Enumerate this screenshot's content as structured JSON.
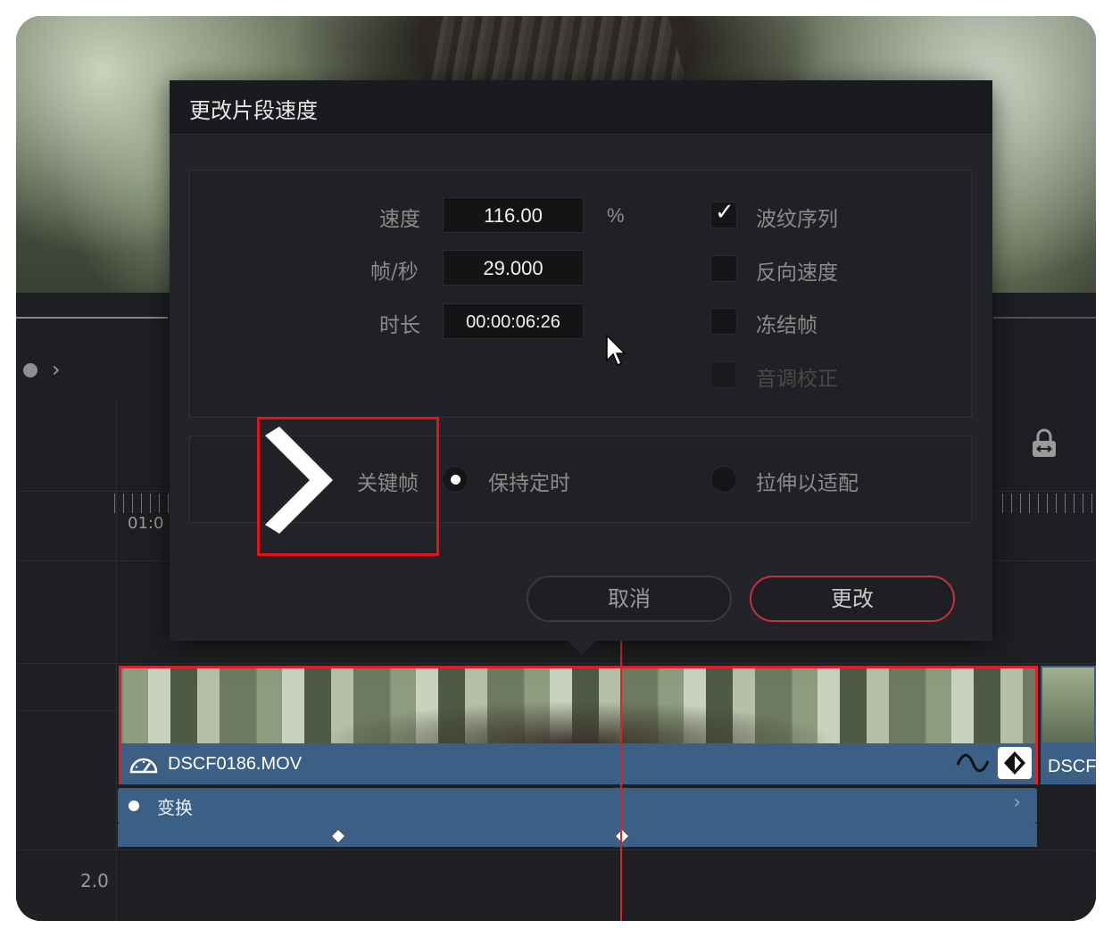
{
  "dialog": {
    "title": "更改片段速度",
    "speed_label": "速度",
    "speed_value": "116.00",
    "speed_unit": "%",
    "fps_label": "帧/秒",
    "fps_value": "29.000",
    "duration_label": "时长",
    "duration_value": "00:00:06:26",
    "options": {
      "ripple": {
        "label": "波纹序列",
        "checked": true
      },
      "reverse": {
        "label": "反向速度",
        "checked": false
      },
      "freeze": {
        "label": "冻结帧",
        "checked": false
      },
      "pitch": {
        "label": "音调校正",
        "checked": false,
        "disabled": true
      }
    },
    "keyframes_label": "关键帧",
    "keyframe_modes": {
      "maintain": {
        "label": "保持定时",
        "selected": true
      },
      "stretch": {
        "label": "拉伸以适配",
        "selected": false
      }
    },
    "cancel_label": "取消",
    "change_label": "更改"
  },
  "timeline": {
    "timecode": "01:0",
    "clip_name": "DSCF0186.MOV",
    "next_clip_name": "DSCF",
    "transform_label": "变换",
    "track_value": "2.0"
  },
  "colors": {
    "accent_red": "#d9232c",
    "clip_blue": "#3c5f86",
    "dialog_bg": "#232428"
  }
}
